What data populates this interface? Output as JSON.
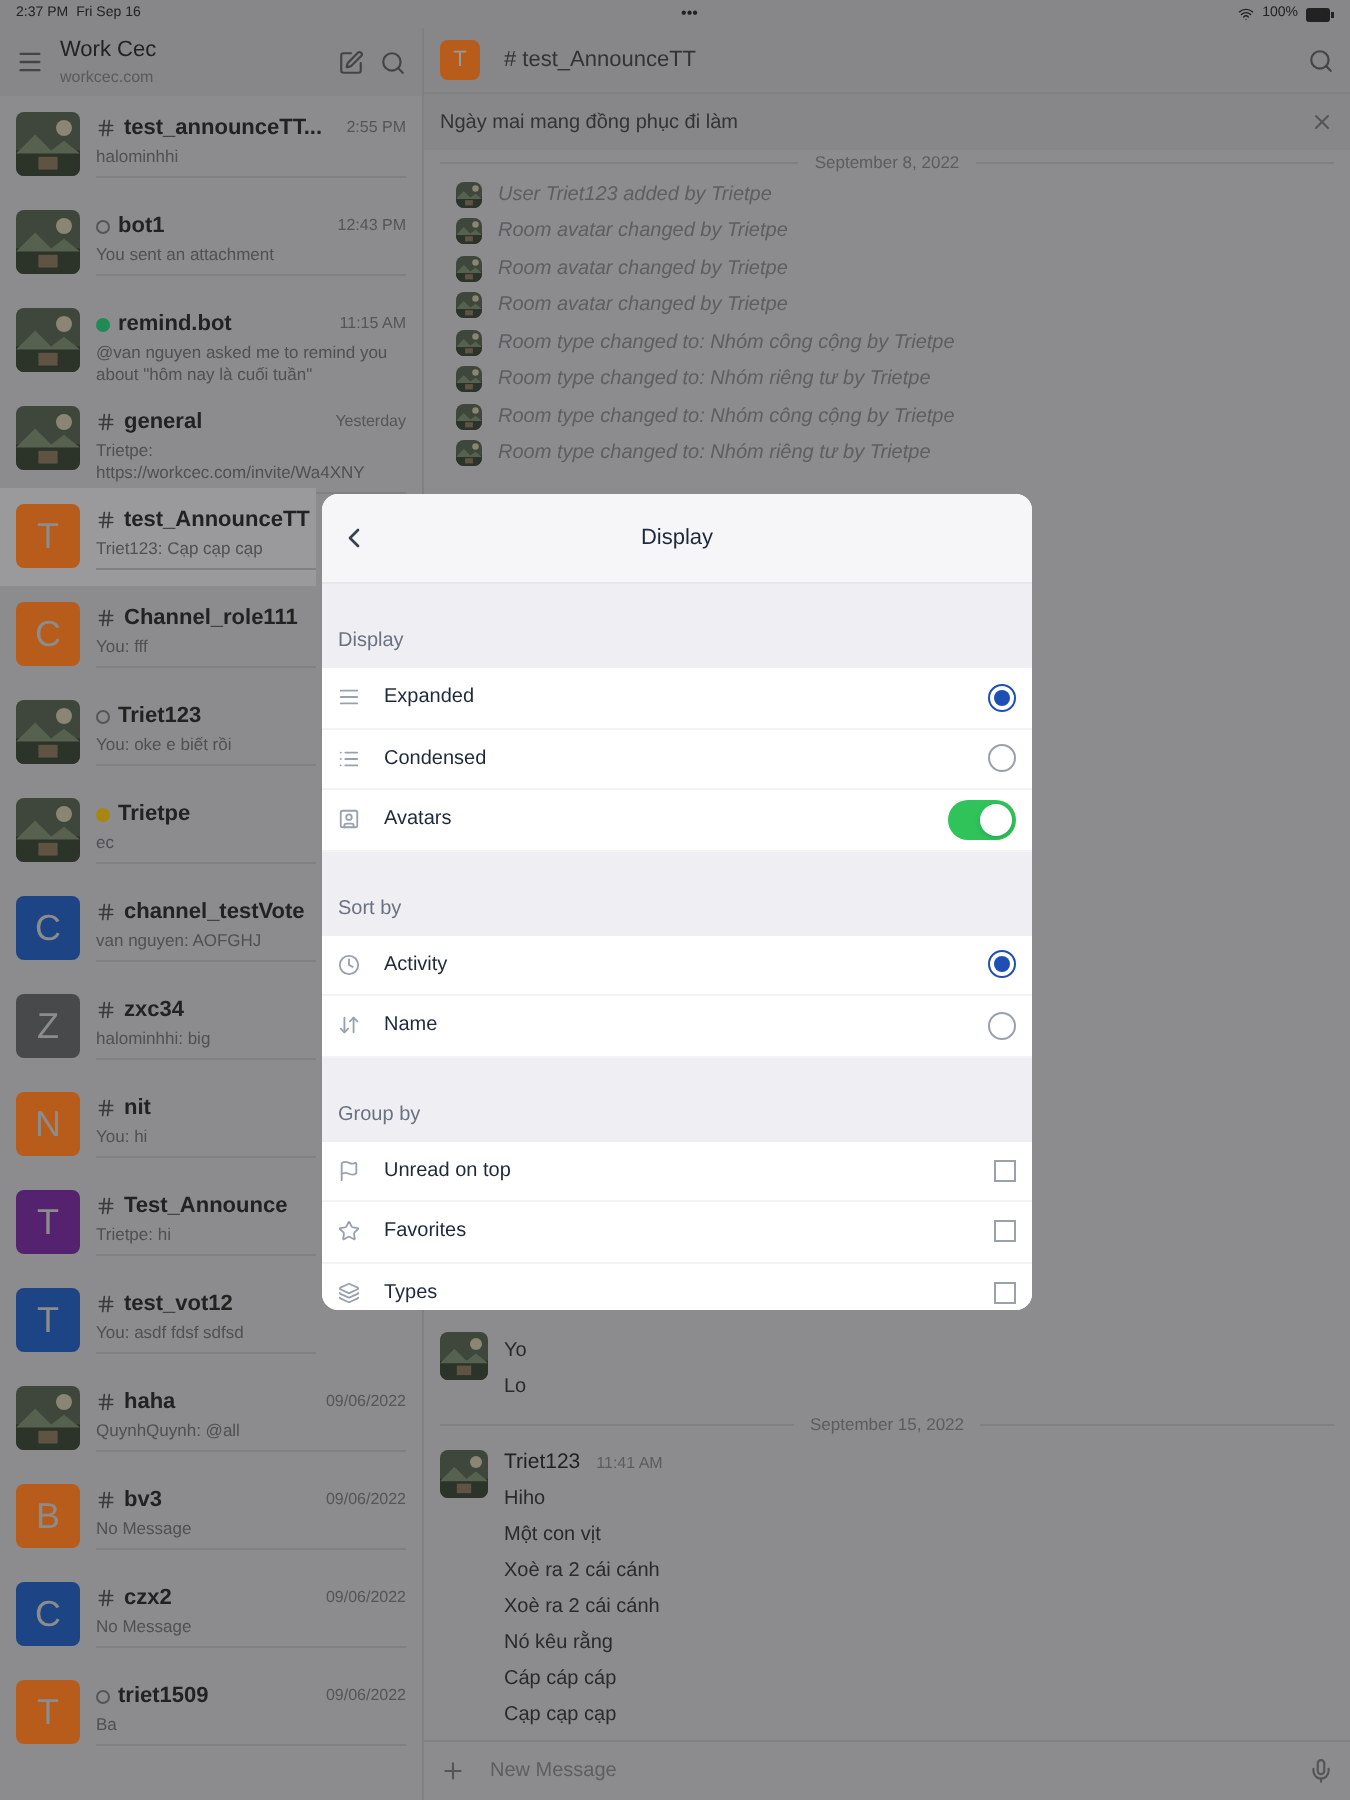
{
  "status_bar": {
    "time": "2:37 PM",
    "date": "Fri Sep 16",
    "dots": "•••",
    "battery": "100%"
  },
  "sidebar": {
    "title": "Work Cec",
    "subtitle": "workcec.com",
    "rooms": [
      {
        "kind": "channel",
        "name": "test_announceTT...",
        "time": "2:55 PM",
        "preview": "halominhhi",
        "selected": false
      },
      {
        "kind": "offline",
        "name": "bot1",
        "time": "12:43 PM",
        "preview": "You sent an attachment",
        "selected": false
      },
      {
        "kind": "online",
        "name": "remind.bot",
        "time": "11:15 AM",
        "preview": "@van nguyen asked me to remind you about \"hôm nay là cuối tuần\"",
        "selected": false
      },
      {
        "kind": "channel",
        "name": "general",
        "time": "Yesterday",
        "preview": "Trietpe: https://workcec.com/invite/Wa4XNY",
        "selected": false
      },
      {
        "kind": "channel",
        "letter": "T",
        "color": "#b85c1c",
        "name": "test_AnnounceTT",
        "preview": "Triet123: Cạp cạp cạp",
        "selected": true
      },
      {
        "kind": "channel",
        "letter": "C",
        "color": "#b85c1c",
        "name": "Channel_role111",
        "preview": "You: fff",
        "selected": false
      },
      {
        "kind": "offline",
        "name": "Triet123",
        "preview": "You: oke e biết rồi",
        "selected": false
      },
      {
        "kind": "away",
        "name": "Trietpe",
        "preview": "ec",
        "selected": false
      },
      {
        "kind": "channel",
        "letter": "C",
        "color": "#1d4585",
        "name": "channel_testVote",
        "preview": "van nguyen: AOFGHJ",
        "selected": false
      },
      {
        "kind": "channel",
        "letter": "Z",
        "color": "#48494b",
        "name": "zxc34",
        "preview": "halominhhi: big",
        "selected": false
      },
      {
        "kind": "channel",
        "letter": "N",
        "color": "#b85c1c",
        "name": "nit",
        "preview": "You: hi",
        "selected": false
      },
      {
        "kind": "channel",
        "letter": "T",
        "color": "#55226f",
        "name": "Test_Announce",
        "preview": "Trietpe: hi",
        "selected": false
      },
      {
        "kind": "channel",
        "letter": "T",
        "color": "#1d4585",
        "name": "test_vot12",
        "preview": "You: asdf fdsf sdfsd",
        "selected": false
      },
      {
        "kind": "channel",
        "name": "haha",
        "time": "09/06/2022",
        "preview": "QuynhQuynh: @all",
        "selected": false
      },
      {
        "kind": "channel",
        "letter": "B",
        "color": "#b85c1c",
        "name": "bv3",
        "time": "09/06/2022",
        "preview": "No Message",
        "selected": false
      },
      {
        "kind": "channel",
        "letter": "C",
        "color": "#1d4585",
        "name": "czx2",
        "time": "09/06/2022",
        "preview": "No Message",
        "selected": false
      },
      {
        "kind": "offline",
        "letter": "T",
        "color": "#b85c1c",
        "name": "triet1509",
        "time": "09/06/2022",
        "preview": "Ba",
        "selected": false
      }
    ]
  },
  "room": {
    "letter": "T",
    "name": "# test_AnnounceTT",
    "announcement": "Ngày mai mang đồng phục đi làm",
    "top_date": "September 8, 2022",
    "system_messages": [
      "User Triet123 added by Trietpe",
      "Room avatar changed by Trietpe",
      "Room avatar changed by Trietpe",
      "Room avatar changed by Trietpe",
      "Room type changed to: Nhóm công cộng by Trietpe",
      "Room type changed to: Nhóm riêng tư by Trietpe",
      "Room type changed to: Nhóm công cộng by Trietpe",
      "Room type changed to: Nhóm riêng tư by Trietpe"
    ],
    "earlier_lines": [
      "Yo",
      "Lo"
    ],
    "bottom_date": "September 15, 2022",
    "last_group": {
      "author": "Triet123",
      "time": "11:41 AM",
      "lines": [
        "Hiho",
        "Một con vịt",
        "Xoè ra 2 cái cánh",
        "Xoè ra 2 cái cánh",
        "Nó kêu rằng",
        "Cáp cáp cáp",
        "Cạp cạp cạp"
      ]
    },
    "composer": {
      "placeholder": "New Message"
    }
  },
  "dialog": {
    "title": "Display",
    "sections": [
      {
        "title": "Display",
        "items": [
          {
            "kind": "radio",
            "label": "Expanded",
            "selected": true
          },
          {
            "kind": "radio",
            "label": "Condensed",
            "selected": false
          },
          {
            "kind": "switch",
            "label": "Avatars",
            "on": true
          }
        ]
      },
      {
        "title": "Sort by",
        "items": [
          {
            "kind": "radio",
            "label": "Activity",
            "selected": true
          },
          {
            "kind": "radio",
            "label": "Name",
            "selected": false
          }
        ]
      },
      {
        "title": "Group by",
        "items": [
          {
            "kind": "checkbox",
            "label": "Unread on top",
            "checked": false
          },
          {
            "kind": "checkbox",
            "label": "Favorites",
            "checked": false
          },
          {
            "kind": "checkbox",
            "label": "Types",
            "checked": false
          }
        ]
      }
    ]
  }
}
